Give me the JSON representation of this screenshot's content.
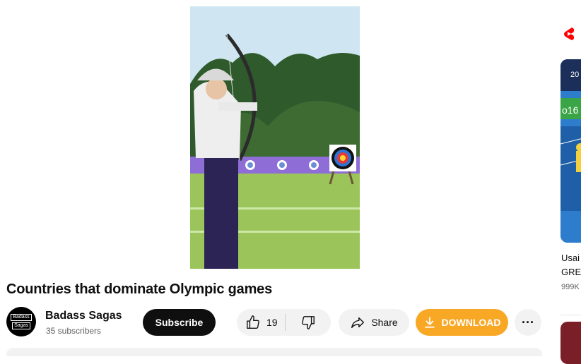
{
  "video": {
    "title": "Countries that dominate Olympic games",
    "thumbnail_icon": "archer-scene-image"
  },
  "channel": {
    "name": "Badass Sagas",
    "subscribers": "35 subscribers",
    "avatar_text_top": "Badass",
    "avatar_text_bottom": "Sagas"
  },
  "actions": {
    "subscribe_label": "Subscribe",
    "like_count": "19",
    "share_label": "Share",
    "download_label": "DOWNLOAD",
    "more_label": "···"
  },
  "shorts_shelf": {
    "icon": "shorts-icon",
    "items": [
      {
        "title_line1": "Usai",
        "title_line2": "GRE",
        "views": "999K",
        "thumb_text_1": "20",
        "thumb_text_2": "o16"
      }
    ]
  },
  "colors": {
    "subscribe_bg": "#0f0f0f",
    "download_bg": "#f9a825",
    "shorts_red": "#ff0000",
    "pill_bg": "#f2f2f2"
  }
}
